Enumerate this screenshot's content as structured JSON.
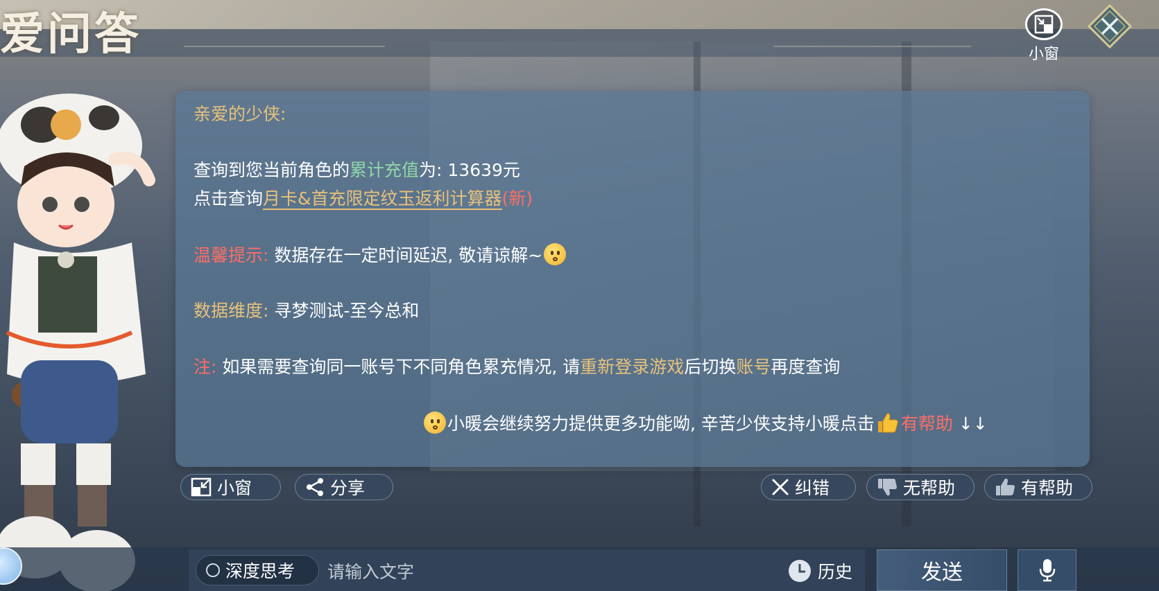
{
  "header": {
    "title_logo": "爱问答",
    "mini_window_label": "小窗"
  },
  "message": {
    "greeting": "亲爱的少侠:",
    "recharge_prefix": "查询到您当前角色的",
    "recharge_highlight": "累计充值",
    "recharge_suffix": "为: 13639元",
    "calc_prefix": "点击查询",
    "calc_link": "月卡&首充限定纹玉返利计算器",
    "calc_new": "(新)",
    "tip_label": "温馨提示:",
    "tip_text": "数据存在一定时间延迟, 敬请谅解~",
    "dimension_label": "数据维度:",
    "dimension_text": "寻梦测试-至今总和",
    "note_label": "注:",
    "note_text_1": "如果需要查询同一账号下不同角色累充情况, 请",
    "note_highlight_1": "重新登录游戏",
    "note_text_2": "后切换",
    "note_highlight_2": "账号",
    "note_text_3": "再度查询",
    "footer_text": "小暖会继续努力提供更多功能呦, 辛苦少侠支持小暖点击",
    "footer_helpful": "有帮助",
    "footer_arrows": "↓↓"
  },
  "actions": {
    "mini_window": "小窗",
    "share": "分享",
    "correct": "纠错",
    "not_helpful": "无帮助",
    "helpful": "有帮助"
  },
  "input_bar": {
    "deep_think": "深度思考",
    "placeholder": "请输入文字",
    "history": "历史",
    "send": "发送"
  },
  "colors": {
    "gold": "#e8c27a",
    "green": "#8fd8a8",
    "red": "#ff6e66",
    "panel": "#5a7896"
  }
}
